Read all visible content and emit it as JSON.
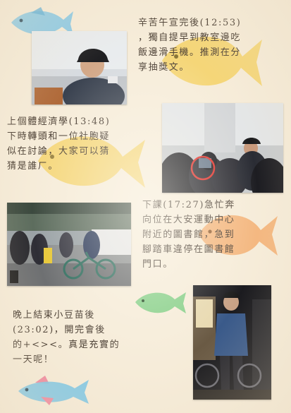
{
  "captions": {
    "caption1": "辛苦午宣完後(12:53)\n，獨自提早到教室邊吃\n飯邊滑手機。推測在分\n享抽獎文。",
    "caption2": "上個體經濟學(13:48)\n下時轉頭和一位社胞疑\n似在討論，大家可以猜\n猜是誰ㄏ。",
    "caption3": "下課(17:27)急忙奔\n向位在大安運動中心\n附近的圖書館，急到\n腳踏車違停在圖書館\n門口。",
    "caption4": "晚上結束小豆苗後\n(23:02)，開完會後\n的+<><。真是充實的\n一天呢！"
  },
  "colors": {
    "paper": "#f6ecd9",
    "fish_blue": "#7cc6e6",
    "fish_yellow": "#f4cf57",
    "fish_orange": "#f2a45e",
    "fish_green": "#88d08a",
    "fish_pink": "#f08aa0",
    "highlight_circle": "#e0302a"
  }
}
